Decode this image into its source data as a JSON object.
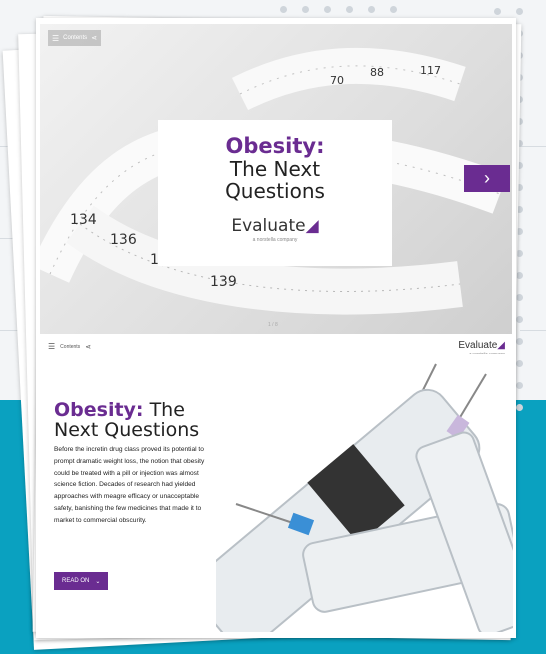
{
  "slide1": {
    "menu_label": "Contents",
    "title_line1": "Obesity:",
    "title_line2": "The Next",
    "title_line3": "Questions",
    "brand": "Evaluate",
    "brand_sub": "a norstella company",
    "page_indicator": "1 / 8"
  },
  "slide2": {
    "menu_label": "Contents",
    "brand": "Evaluate",
    "brand_sub": "a norstella company",
    "heading_purple": "Obesity:",
    "heading_rest": " The",
    "heading_line2": "Next Questions",
    "body": "Before the incretin drug class proved its potential to prompt dramatic weight loss, the notion that obesity could be treated with a pill or injection was almost science fiction. Decades of research had yielded approaches with meagre efficacy or unacceptable safety, banishing the few medicines that made it to market to commercial obscurity.",
    "read_on": "READ ON"
  },
  "colors": {
    "brand_purple": "#6a2c91",
    "teal": "#0aa1c0"
  }
}
